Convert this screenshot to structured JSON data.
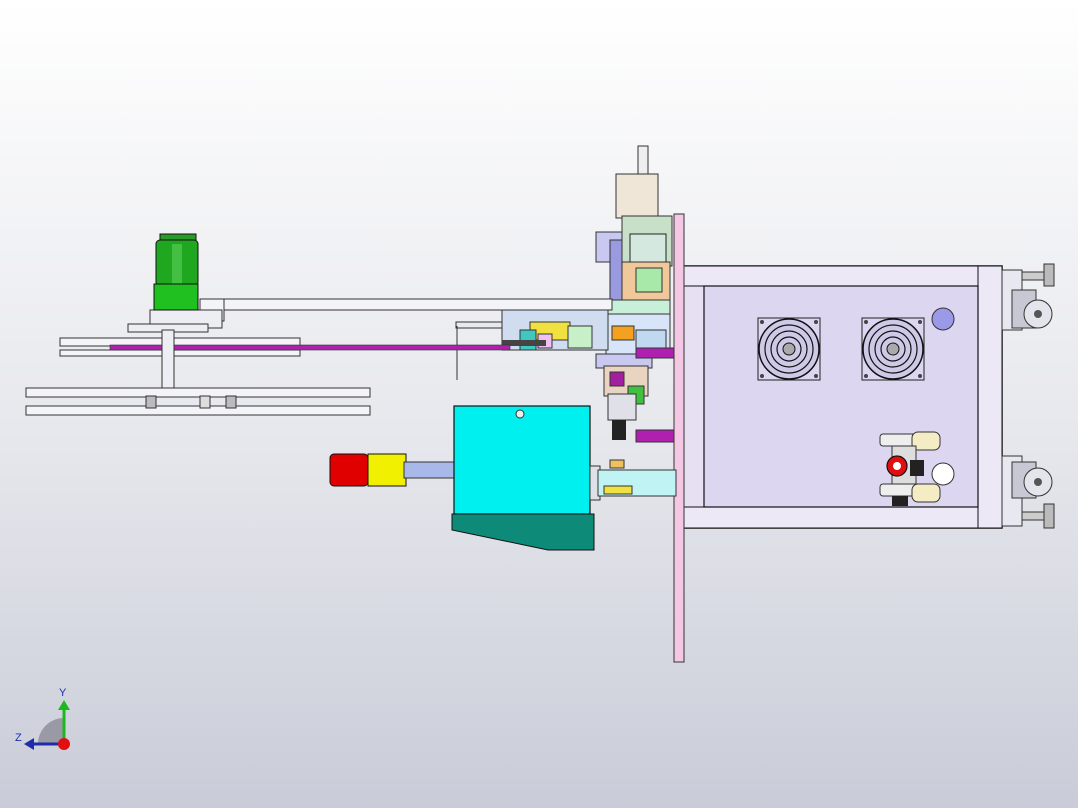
{
  "viewport": {
    "background_top": "#ffffff",
    "background_bottom": "#c9ccd8"
  },
  "triad": {
    "y_label": "Y",
    "z_label": "Z",
    "y_color": "#1db81d",
    "z_color": "#1f2ea8",
    "x_color": "#e01010"
  },
  "machine": {
    "frame_color": "#e6e0f2",
    "panel_color": "#dcd6f0",
    "plate_color": "#f4c8e4",
    "motor_color": "#1fa81f",
    "cylinder_color": "#00f0f0",
    "cylinder_base_color": "#0d8a78",
    "tower_light_colors": [
      "#e00000",
      "#f0f000",
      "#a8b8e8"
    ],
    "belt_color": "#b020b0",
    "fan_count": 2
  }
}
